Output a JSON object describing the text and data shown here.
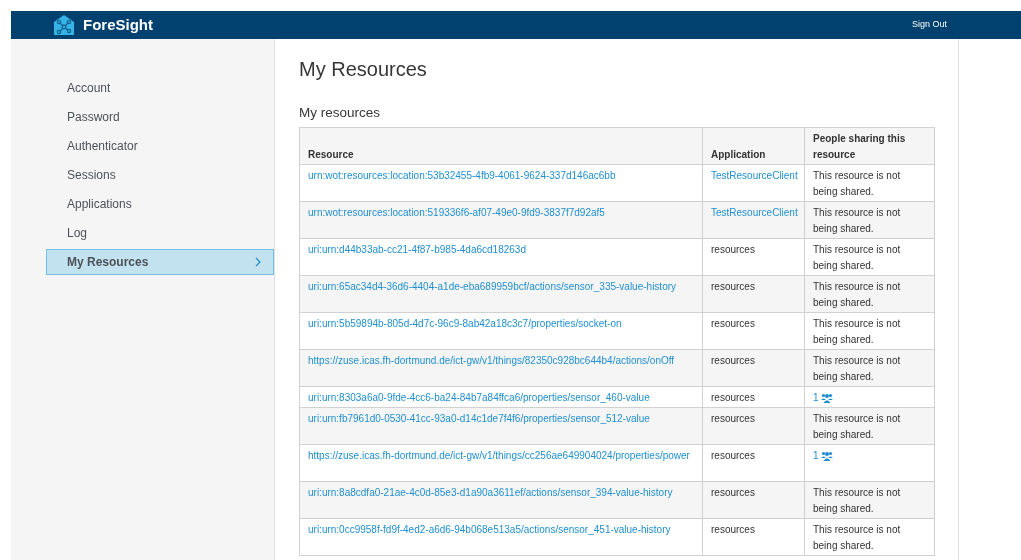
{
  "header": {
    "brand": "ForeSight",
    "sign_out": "Sign Out"
  },
  "sidebar": {
    "items": [
      {
        "label": "Account",
        "selected": false
      },
      {
        "label": "Password",
        "selected": false
      },
      {
        "label": "Authenticator",
        "selected": false
      },
      {
        "label": "Sessions",
        "selected": false
      },
      {
        "label": "Applications",
        "selected": false
      },
      {
        "label": "Log",
        "selected": false
      },
      {
        "label": "My Resources",
        "selected": true
      }
    ]
  },
  "page_title": "My Resources",
  "section_title": "My resources",
  "table": {
    "columns": [
      "Resource",
      "Application",
      "People sharing this resource"
    ],
    "rows": [
      {
        "resource": "urn:wot:resources:location:53b32455-4fb9-4061-9624-337d146ac6bb",
        "application": "TestResourceClient",
        "application_link": true,
        "sharing": {
          "kind": "not_shared",
          "text": "This resource is not being shared."
        }
      },
      {
        "resource": "urn:wot:resources:location:519336f6-af07-49e0-9fd9-3837f7d92af5",
        "application": "TestResourceClient",
        "application_link": true,
        "sharing": {
          "kind": "not_shared",
          "text": "This resource is not being shared."
        }
      },
      {
        "resource": "uri:urn:d44b33ab-cc21-4f87-b985-4da6cd18263d",
        "application": "resources",
        "application_link": false,
        "sharing": {
          "kind": "not_shared",
          "text": "This resource is not being shared."
        }
      },
      {
        "resource": "uri:urn:65ac34d4-36d6-4404-a1de-eba689959bcf/actions/sensor_335-value-history",
        "application": "resources",
        "application_link": false,
        "sharing": {
          "kind": "not_shared",
          "text": "This resource is not being shared."
        }
      },
      {
        "resource": "uri:urn:5b59894b-805d-4d7c-96c9-8ab42a18c3c7/properties/socket-on",
        "application": "resources",
        "application_link": false,
        "sharing": {
          "kind": "not_shared",
          "text": "This resource is not being shared."
        }
      },
      {
        "resource": "https://zuse.icas.fh-dortmund.de/ict-gw/v1/things/82350c928bc644b4/actions/onOff",
        "application": "resources",
        "application_link": false,
        "sharing": {
          "kind": "not_shared",
          "text": "This resource is not being shared."
        }
      },
      {
        "resource": "uri:urn:8303a6a0-9fde-4cc6-ba24-84b7a84ffca6/properties/sensor_460-value",
        "application": "resources",
        "application_link": false,
        "sharing": {
          "kind": "shared",
          "text": "1"
        }
      },
      {
        "resource": "uri:urn:fb7961d0-0530-41cc-93a0-d14c1de7f4f6/properties/sensor_512-value",
        "application": "resources",
        "application_link": false,
        "sharing": {
          "kind": "not_shared",
          "text": "This resource is not being shared."
        }
      },
      {
        "resource": "https://zuse.icas.fh-dortmund.de/ict-gw/v1/things/cc256ae649904024/properties/power",
        "application": "resources",
        "application_link": false,
        "sharing": {
          "kind": "shared",
          "text": "1"
        }
      },
      {
        "resource": "uri:urn:8a8cdfa0-21ae-4c0d-85e3-d1a90a3611ef/actions/sensor_394-value-history",
        "application": "resources",
        "application_link": false,
        "sharing": {
          "kind": "not_shared",
          "text": "This resource is not being shared."
        }
      },
      {
        "resource": "uri:urn:0cc9958f-fd9f-4ed2-a6d6-94b068e513a5/actions/sensor_451-value-history",
        "application": "resources",
        "application_link": false,
        "sharing": {
          "kind": "not_shared",
          "text": "This resource is not being shared."
        }
      }
    ]
  }
}
